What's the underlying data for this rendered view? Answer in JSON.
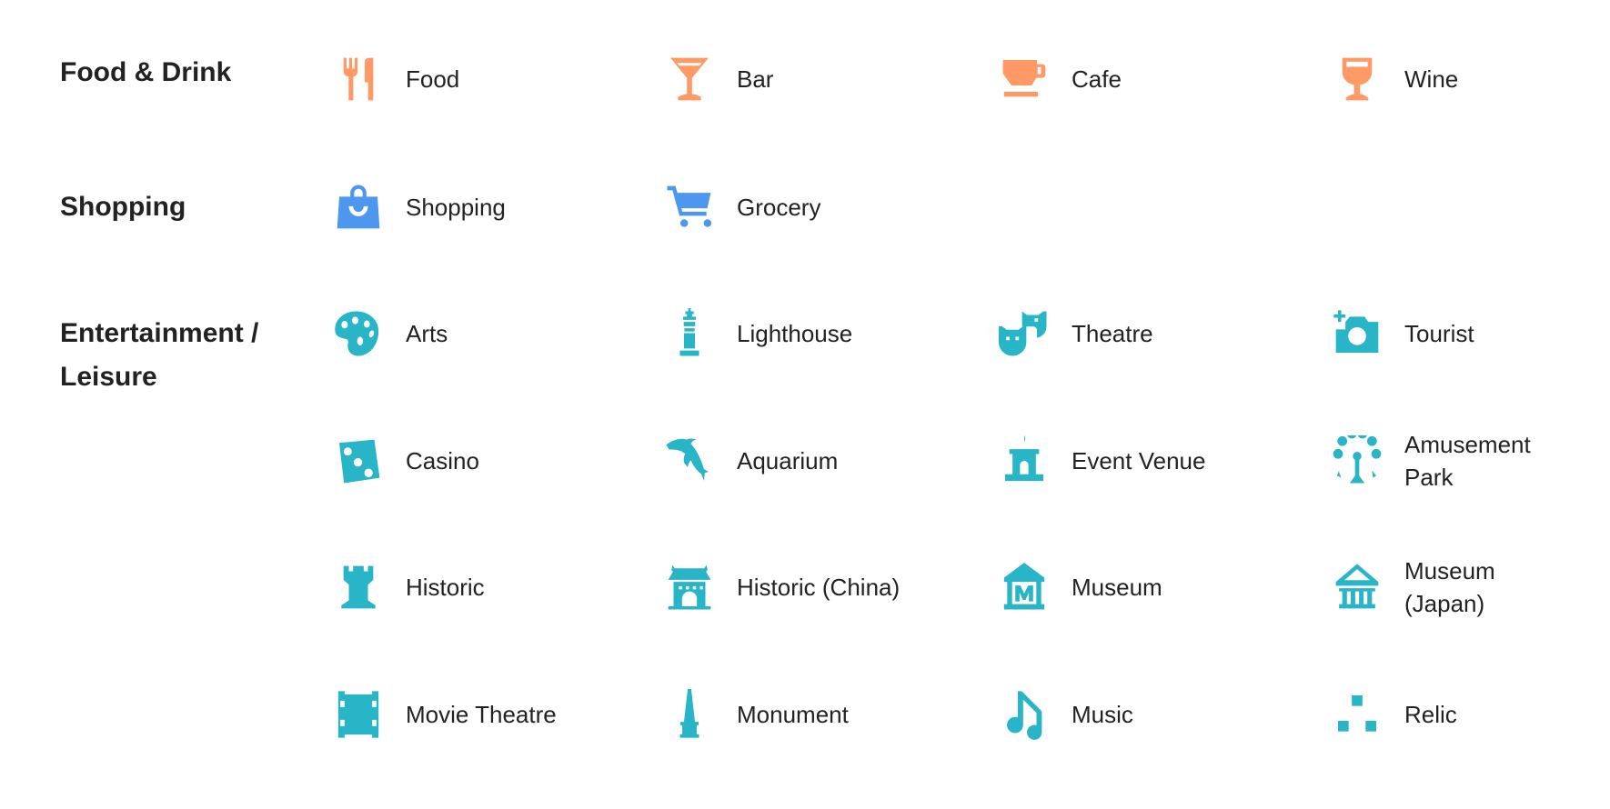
{
  "colors": {
    "food": "#FF9966",
    "shopping": "#4E97EE",
    "entertainment": "#28B5C8",
    "text": "#222222"
  },
  "categories": [
    {
      "name": "Food & Drink",
      "name_lines": [
        "Food & Drink"
      ],
      "color_key": "food",
      "items": [
        {
          "label_lines": [
            "Food"
          ],
          "icon": "fork-knife-icon"
        },
        {
          "label_lines": [
            "Bar"
          ],
          "icon": "cocktail-glass-icon"
        },
        {
          "label_lines": [
            "Cafe"
          ],
          "icon": "coffee-cup-icon"
        },
        {
          "label_lines": [
            "Wine"
          ],
          "icon": "wine-glass-icon"
        }
      ]
    },
    {
      "name": "Shopping",
      "name_lines": [
        "Shopping"
      ],
      "color_key": "shopping",
      "items": [
        {
          "label_lines": [
            "Shopping"
          ],
          "icon": "shopping-bag-icon"
        },
        {
          "label_lines": [
            "Grocery"
          ],
          "icon": "shopping-cart-icon"
        }
      ]
    },
    {
      "name": "Entertainment / Leisure",
      "name_lines": [
        "Entertainment /",
        "Leisure"
      ],
      "color_key": "entertainment",
      "items": [
        {
          "label_lines": [
            "Arts"
          ],
          "icon": "palette-icon"
        },
        {
          "label_lines": [
            "Lighthouse"
          ],
          "icon": "lighthouse-icon"
        },
        {
          "label_lines": [
            "Theatre"
          ],
          "icon": "theatre-masks-icon"
        },
        {
          "label_lines": [
            "Tourist"
          ],
          "icon": "camera-icon"
        },
        {
          "label_lines": [
            "Casino"
          ],
          "icon": "dice-icon"
        },
        {
          "label_lines": [
            "Aquarium"
          ],
          "icon": "dolphin-icon"
        },
        {
          "label_lines": [
            "Event Venue"
          ],
          "icon": "event-venue-icon"
        },
        {
          "label_lines": [
            "Amusement",
            "Park"
          ],
          "icon": "ferris-wheel-icon"
        },
        {
          "label_lines": [
            "Historic"
          ],
          "icon": "castle-tower-icon"
        },
        {
          "label_lines": [
            "Historic (China)"
          ],
          "icon": "chinese-gate-icon"
        },
        {
          "label_lines": [
            "Museum"
          ],
          "icon": "museum-m-icon"
        },
        {
          "label_lines": [
            "Museum",
            "(Japan)"
          ],
          "icon": "museum-columns-icon"
        },
        {
          "label_lines": [
            "Movie Theatre"
          ],
          "icon": "film-strip-icon"
        },
        {
          "label_lines": [
            "Monument"
          ],
          "icon": "obelisk-icon"
        },
        {
          "label_lines": [
            "Music"
          ],
          "icon": "music-note-icon"
        },
        {
          "label_lines": [
            "Relic"
          ],
          "icon": "relic-blocks-icon"
        }
      ]
    }
  ]
}
